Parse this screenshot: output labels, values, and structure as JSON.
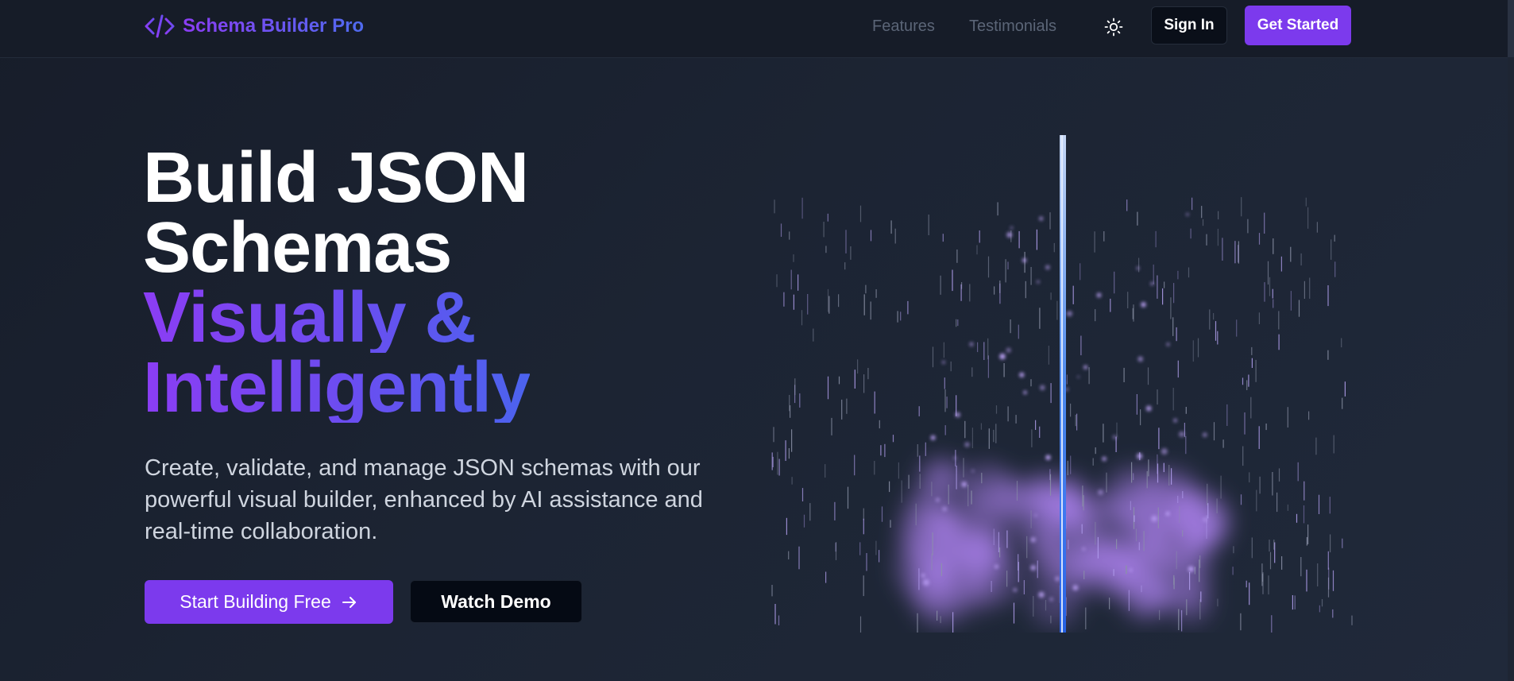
{
  "brand": {
    "name": "Schema Builder Pro",
    "icon": "code-icon",
    "gradient": [
      "#8b3df4",
      "#4f6bef"
    ]
  },
  "nav": {
    "links": [
      {
        "label": "Features"
      },
      {
        "label": "Testimonials"
      }
    ],
    "theme_toggle_icon": "sun-icon",
    "sign_in": "Sign In",
    "get_started": "Get Started"
  },
  "hero": {
    "title_line1": "Build JSON",
    "title_line2": "Schemas",
    "title_line3": "Visually &",
    "title_line4": "Intelligently",
    "description": "Create, validate, and manage JSON schemas with our powerful visual builder, enhanced by AI assistance and real-time collaboration.",
    "primary_cta": "Start Building Free",
    "primary_cta_icon": "arrow-right-icon",
    "secondary_cta": "Watch Demo"
  },
  "colors": {
    "accent": "#7c3aed",
    "background": "#1b2231",
    "beam": "#3b82f6",
    "particles": "#a78bfa"
  }
}
